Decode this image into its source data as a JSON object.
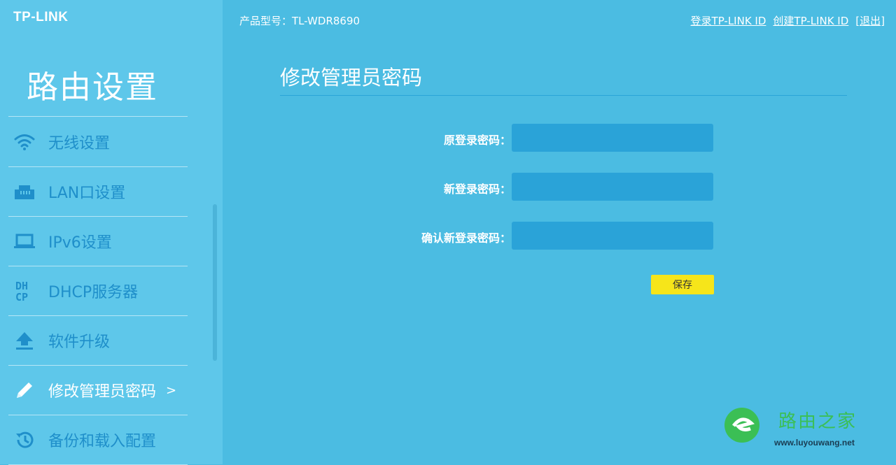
{
  "brand": {
    "logo": "TP-LINK"
  },
  "header": {
    "model": "产品型号：TL-WDR8690",
    "links": [
      "登录TP-LINK ID",
      "创建TP-LINK ID",
      "[退出]"
    ]
  },
  "sidebar": {
    "title": "路由设置",
    "items": [
      {
        "label": "无线设置",
        "icon": "wifi-icon"
      },
      {
        "label": "LAN口设置",
        "icon": "ethernet-port-icon"
      },
      {
        "label": "IPv6设置",
        "icon": "laptop-icon"
      },
      {
        "label": "DHCP服务器",
        "icon": "dhcp-icon"
      },
      {
        "label": "软件升级",
        "icon": "upload-icon"
      },
      {
        "label": "修改管理员密码",
        "icon": "pencil-icon",
        "active": true,
        "arrow": ">"
      },
      {
        "label": "备份和载入配置",
        "icon": "history-icon"
      }
    ]
  },
  "main": {
    "title": "修改管理员密码",
    "fields": [
      {
        "label": "原登录密码：",
        "value": ""
      },
      {
        "label": "新登录密码：",
        "value": ""
      },
      {
        "label": "确认新登录密码：",
        "value": ""
      }
    ],
    "save_label": "保存"
  },
  "watermark": {
    "text": "路由之家",
    "url": "www.luyouwang.net"
  },
  "colors": {
    "background": "#4bbce2",
    "sidebar": "#5ec7ea",
    "input": "#2aa3d8",
    "save_button": "#f6e51a",
    "menu_text": "#1f8fca"
  }
}
